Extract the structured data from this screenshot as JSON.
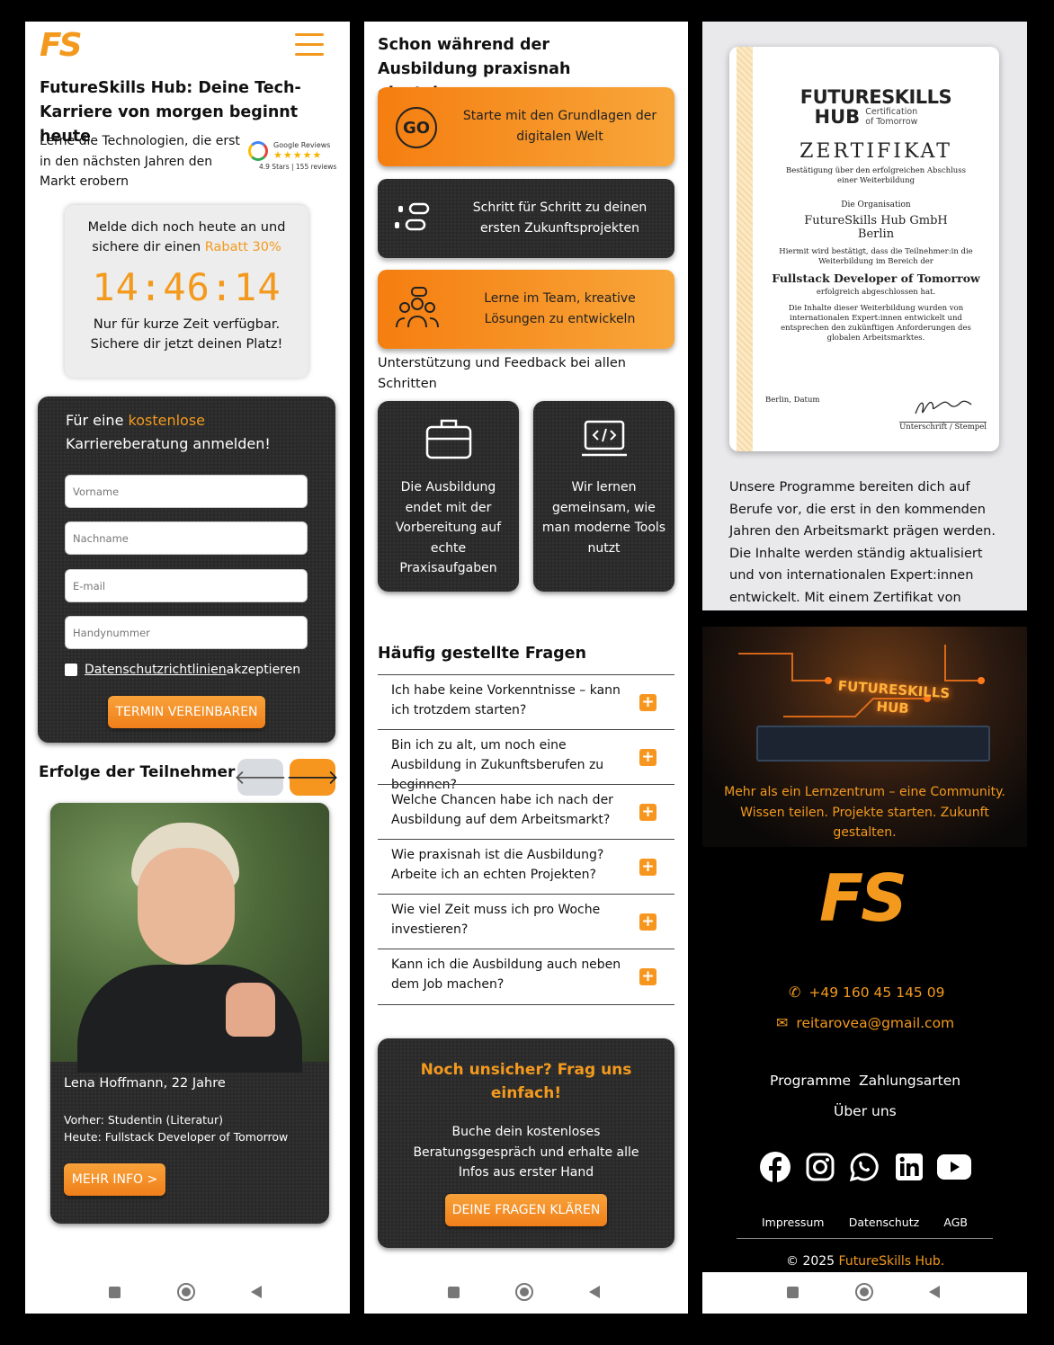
{
  "col1": {
    "logo": "FS",
    "headline": "FutureSkills Hub: Deine Tech-Karriere von morgen beginnt heute",
    "lead": "Lerne die Technologien, die erst in den nächsten Jahren den Markt erobern",
    "google": {
      "title": "Google Reviews",
      "stars": "★★★★★",
      "meta": "4.9 Stars | 155 reviews"
    },
    "promo": {
      "line1": "Melde dich noch heute an und",
      "line2_prefix": "sichere dir einen ",
      "line2_highlight": "Rabatt 30%",
      "timer": "14:46:14",
      "line3": "Nur für kurze Zeit verfügbar.",
      "line4": "Sichere dir jetzt deinen Platz!"
    },
    "form": {
      "title_prefix": "Für eine ",
      "title_highlight": "kostenlose",
      "title_rest": "Karriereberatung anmelden!",
      "first_name_placeholder": "Vorname",
      "last_name_placeholder": "Nachname",
      "email_placeholder": "E-mail",
      "phone_placeholder": "Handynummer",
      "privacy_link": "Datenschutzrichtlinien",
      "privacy_rest": " akzeptieren",
      "submit": "TERMIN VEREINBAREN"
    },
    "testimonials": {
      "title": "Erfolge der Teilnehmer",
      "prev": "🡐",
      "next": "🡒",
      "name": "Lena Hoffmann, 22 Jahre",
      "before": "Vorher: Studentin (Literatur)",
      "now": "Heute: Fullstack Developer of Tomorrow",
      "button": "MEHR INFO >"
    }
  },
  "col2": {
    "heading": "Schon während der Ausbildung praxisnah einsteigen",
    "steps": [
      {
        "badge": "GO",
        "text": "Starte mit den Grundlagen der digitalen Welt"
      },
      {
        "text": "Schritt für Schritt zu deinen ersten Zukunftsprojekten"
      },
      {
        "text": "Lerne im Team, kreative Lösungen zu entwickeln"
      }
    ],
    "support": "Unterstützung und Feedback bei allen Schritten",
    "cards": [
      {
        "text": "Die Ausbildung endet mit der Vorbereitung auf echte Praxisaufgaben"
      },
      {
        "text": "Wir lernen gemeinsam, wie man moderne Tools nutzt"
      }
    ],
    "faq_title": "Häufig gestellte Fragen",
    "faq": [
      "Ich habe keine Vorkenntnisse – kann ich trotzdem starten?",
      "Bin ich zu alt, um noch eine Ausbildung in Zukunftsberufen zu beginnen?",
      "Welche Chancen habe ich nach der Ausbildung auf dem Arbeitsmarkt?",
      "Wie praxisnah ist die Ausbildung? Arbeite ich an echten Projekten?",
      "Wie viel Zeit muss ich pro Woche investieren?",
      "Kann ich die Ausbildung auch neben dem Job machen?"
    ],
    "faq_plus": "+",
    "cta": {
      "title": "Noch unsicher? Frag uns einfach!",
      "text": "Buche dein kostenloses Beratungsgespräch und erhalte alle Infos aus erster Hand",
      "button": "DEINE FRAGEN KLÄREN"
    }
  },
  "col3": {
    "certificate": {
      "brand1": "FUTURESKILLS",
      "brand2": "HUB",
      "tagline1": "Certification",
      "tagline2": "of Tomorrow",
      "title": "ZERTIFIKAT",
      "subtitle": "Bestätigung über den erfolgreichen Abschluss einer Weiterbildung",
      "org_label": "Die Organisation",
      "org_name": "FutureSkills Hub GmbH",
      "org_city": "Berlin",
      "confirm": "Hiermit wird bestätigt, dass die Teilnehmer:in die Weiterbildung im Bereich der",
      "program": "Fullstack Developer of Tomorrow",
      "completed": "erfolgreich abgeschlossen hat.",
      "content_note": "Die Inhalte dieser Weiterbildung wurden von internationalen Expert:innen entwickelt und entsprechen den zukünftigen Anforderungen des globalen Arbeitsmarktes.",
      "place_date": "Berlin, Datum",
      "signature_label": "Unterschrift / Stempel"
    },
    "program_text": "Unsere Programme bereiten dich auf Berufe vor, die erst in den kommenden Jahren den Arbeitsmarkt prägen werden. Die Inhalte werden ständig aktualisiert und von internationalen Expert:innen entwickelt. Mit einem Zertifikat von",
    "hero": {
      "sign1": "FUTURESKILLS",
      "sign2": "HUB",
      "caption": "Mehr als ein Lernzentrum – eine Community. Wissen teilen. Projekte starten. Zukunft gestalten."
    },
    "footer": {
      "logo": "FS",
      "phone": "+49 160 45 145 09",
      "email": "reitarovea@gmail.com",
      "nav1": "Programme",
      "nav2": "Zahlungsarten",
      "nav3": "Über uns",
      "legal": [
        "Impressum",
        "Datenschutz",
        "AGB"
      ],
      "copyright_prefix": "© 2025 ",
      "copyright_brand": "FutureSkills Hub."
    }
  },
  "colors": {
    "accent": "#f39a1e",
    "dark": "#2a2a2a"
  }
}
